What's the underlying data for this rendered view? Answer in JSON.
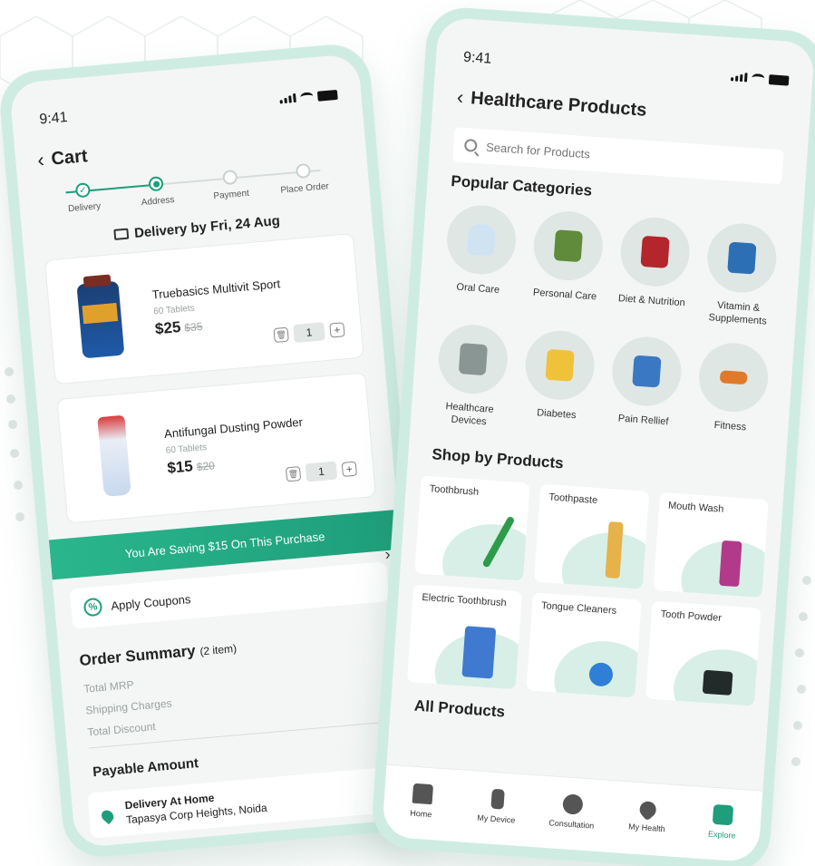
{
  "status": {
    "time": "9:41"
  },
  "cart": {
    "title": "Cart",
    "steps": [
      "Delivery",
      "Address",
      "Payment",
      "Place Order"
    ],
    "delivery_by": "Delivery by Fri, 24 Aug",
    "items": [
      {
        "name": "Truebasics Multivit Sport",
        "sub": "60 Tablets",
        "price": "$25",
        "mrp": "$35",
        "qty": "1"
      },
      {
        "name": "Antifungal Dusting Powder",
        "sub": "60 Tablets",
        "price": "$15",
        "mrp": "$20",
        "qty": "1"
      }
    ],
    "saving_banner": "You Are Saving $15 On This Purchase",
    "apply_coupons": "Apply Coupons",
    "summary_title": "Order Summary",
    "summary_count": "(2 item)",
    "summary_lines": [
      "Total MRP",
      "Shipping Charges",
      "Total Discount"
    ],
    "payable": "Payable Amount",
    "address_title": "Delivery At Home",
    "address_line": "Tapasya Corp Heights, Noida"
  },
  "healthcare": {
    "title": "Healthcare Products",
    "search_placeholder": "Search for Products",
    "popular_title": "Popular Categories",
    "categories": [
      {
        "label": "Oral Care",
        "icon": "tooth-icon",
        "color": "#cfe3f2"
      },
      {
        "label": "Personal Care",
        "icon": "bottles-icon",
        "color": "#5f8b3a"
      },
      {
        "label": "Diet & Nutrition",
        "icon": "protein-jar-icon",
        "color": "#b3262c"
      },
      {
        "label": "Vitamin & Supplements",
        "icon": "supplement-tin-icon",
        "color": "#2c6fb5"
      },
      {
        "label": "Healthcare Devices",
        "icon": "device-icon",
        "color": "#8a9694"
      },
      {
        "label": "Diabetes",
        "icon": "glucose-bottle-icon",
        "color": "#f0c23a"
      },
      {
        "label": "Pain Rellief",
        "icon": "relief-box-icon",
        "color": "#3b78c4"
      },
      {
        "label": "Fitness",
        "icon": "dumbbell-icon",
        "color": "#e07a2a"
      }
    ],
    "shop_title": "Shop by Products",
    "products": [
      {
        "label": "Toothbrush",
        "color": "#2e9b4a"
      },
      {
        "label": "Toothpaste",
        "color": "#e6b24a"
      },
      {
        "label": "Mouth Wash",
        "color": "#b23a8a"
      },
      {
        "label": "Electric Toothbrush",
        "color": "#3f7ad0"
      },
      {
        "label": "Tongue Cleaners",
        "color": "#2f7fd6"
      },
      {
        "label": "Tooth Powder",
        "color": "#222a2a"
      }
    ],
    "all_title": "All Products",
    "tabs": [
      {
        "label": "Home",
        "icon": "home-icon"
      },
      {
        "label": "My Device",
        "icon": "device-icon"
      },
      {
        "label": "Consultation",
        "icon": "doctor-icon"
      },
      {
        "label": "My Health",
        "icon": "heart-icon"
      },
      {
        "label": "Explore",
        "icon": "cart-icon"
      }
    ]
  },
  "colors": {
    "accent": "#1e9e7a",
    "phone_frame": "#cfece3"
  }
}
